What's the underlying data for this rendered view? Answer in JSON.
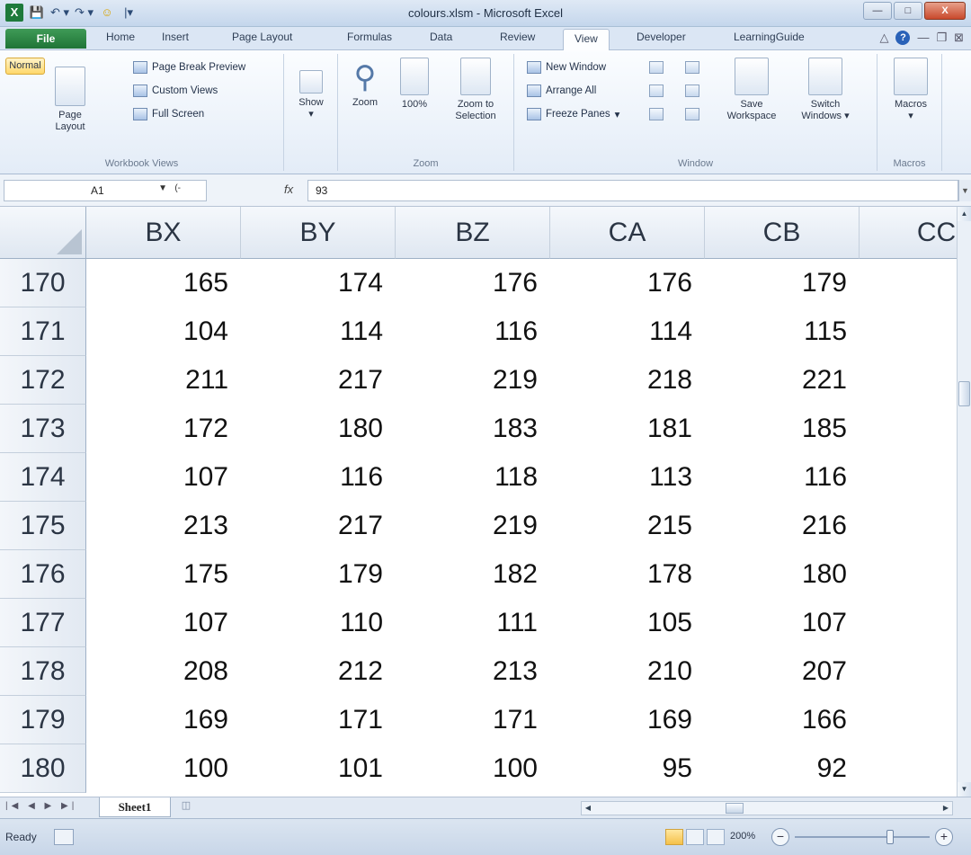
{
  "window": {
    "title": "colours.xlsm - Microsoft Excel",
    "qat_icons": [
      "excel-icon",
      "save-icon",
      "undo-icon",
      "redo-icon",
      "smiley-icon",
      "customize-icon"
    ]
  },
  "tabs": {
    "file": "File",
    "home": "Home",
    "insert": "Insert",
    "page_layout": "Page Layout",
    "formulas": "Formulas",
    "data": "Data",
    "review": "Review",
    "view": "View",
    "developer": "Developer",
    "learningguide": "LearningGuide",
    "active": "View"
  },
  "ribbon": {
    "workbook_views": {
      "label": "Workbook Views",
      "normal": "Normal",
      "page_layout_1": "Page",
      "page_layout_2": "Layout",
      "page_break_preview": "Page Break Preview",
      "custom_views": "Custom Views",
      "full_screen": "Full Screen"
    },
    "show": {
      "label": "Show"
    },
    "zoom": {
      "label": "Zoom",
      "zoom": "Zoom",
      "hundred": "100%",
      "zoom_to_1": "Zoom to",
      "zoom_to_2": "Selection"
    },
    "window": {
      "label": "Window",
      "new_window": "New Window",
      "arrange_all": "Arrange All",
      "freeze_panes": "Freeze Panes",
      "save_ws_1": "Save",
      "save_ws_2": "Workspace",
      "switch_1": "Switch",
      "switch_2": "Windows"
    },
    "macros": {
      "label": "Macros",
      "macros": "Macros"
    }
  },
  "formula_bar": {
    "name_box": "A1",
    "fx": "fx",
    "value": "93"
  },
  "grid": {
    "columns": [
      "BX",
      "BY",
      "BZ",
      "CA",
      "CB",
      "CC"
    ],
    "rows": [
      {
        "num": "170",
        "cells": [
          "165",
          "174",
          "176",
          "176",
          "179"
        ]
      },
      {
        "num": "171",
        "cells": [
          "104",
          "114",
          "116",
          "114",
          "115"
        ]
      },
      {
        "num": "172",
        "cells": [
          "211",
          "217",
          "219",
          "218",
          "221"
        ]
      },
      {
        "num": "173",
        "cells": [
          "172",
          "180",
          "183",
          "181",
          "185"
        ]
      },
      {
        "num": "174",
        "cells": [
          "107",
          "116",
          "118",
          "113",
          "116"
        ]
      },
      {
        "num": "175",
        "cells": [
          "213",
          "217",
          "219",
          "215",
          "216"
        ]
      },
      {
        "num": "176",
        "cells": [
          "175",
          "179",
          "182",
          "178",
          "180"
        ]
      },
      {
        "num": "177",
        "cells": [
          "107",
          "110",
          "111",
          "105",
          "107"
        ]
      },
      {
        "num": "178",
        "cells": [
          "208",
          "212",
          "213",
          "210",
          "207"
        ]
      },
      {
        "num": "179",
        "cells": [
          "169",
          "171",
          "171",
          "169",
          "166"
        ]
      },
      {
        "num": "180",
        "cells": [
          "100",
          "101",
          "100",
          "95",
          "92"
        ]
      }
    ]
  },
  "sheets": {
    "active": "Sheet1"
  },
  "status": {
    "ready": "Ready",
    "zoom": "200%"
  },
  "colors": {
    "accent_file_tab": "#1f7436",
    "selection_highlight": "#f7c44d",
    "header_bg": "#dfe7f1"
  }
}
